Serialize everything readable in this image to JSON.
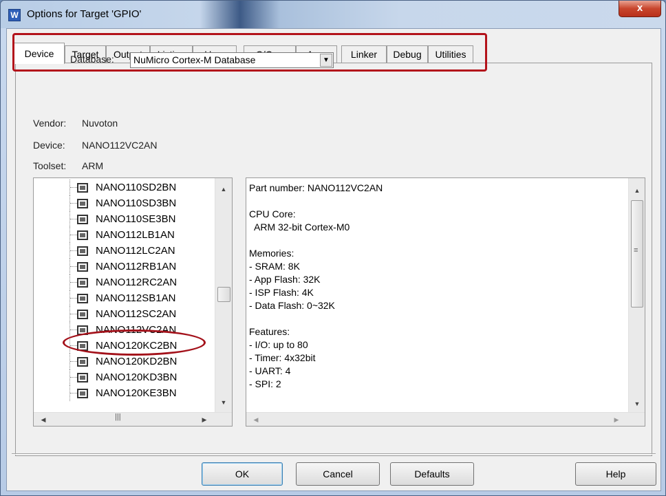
{
  "window": {
    "title": "Options for Target 'GPIO'",
    "close_glyph": "x",
    "app_icon_glyph": "W"
  },
  "tabs": [
    {
      "label": "Device",
      "active": true
    },
    {
      "label": "Target"
    },
    {
      "label": "Output"
    },
    {
      "label": "Listing"
    },
    {
      "label": "User"
    },
    {
      "label": "C/C++"
    },
    {
      "label": "Asm"
    },
    {
      "label": "Linker"
    },
    {
      "label": "Debug"
    },
    {
      "label": "Utilities"
    }
  ],
  "device": {
    "database_label": "Database:",
    "database_value": "NuMicro Cortex-M Database",
    "vendor_label": "Vendor:",
    "vendor_value": "Nuvoton",
    "device_label": "Device:",
    "device_value": "NANO112VC2AN",
    "toolset_label": "Toolset:",
    "toolset_value": "ARM"
  },
  "device_list": [
    "NANO110SD2BN",
    "NANO110SD3BN",
    "NANO110SE3BN",
    "NANO112LB1AN",
    "NANO112LC2AN",
    "NANO112RB1AN",
    "NANO112RC2AN",
    "NANO112SB1AN",
    "NANO112SC2AN",
    "NANO112VC2AN",
    "NANO120KC2BN",
    "NANO120KD2BN",
    "NANO120KD3BN",
    "NANO120KE3BN"
  ],
  "selected_device": "NANO112VC2AN",
  "description": [
    "Part number: NANO112VC2AN",
    "",
    "CPU Core:",
    "  ARM 32-bit Cortex-M0",
    "",
    "Memories:",
    "- SRAM: 8K",
    "- App Flash: 32K",
    "- ISP Flash: 4K",
    "- Data Flash: 0~32K",
    "",
    "Features:",
    "- I/O: up to 80",
    "- Timer: 4x32bit",
    "- UART: 4",
    "- SPI: 2"
  ],
  "buttons": {
    "ok": "OK",
    "cancel": "Cancel",
    "defaults": "Defaults",
    "help": "Help"
  },
  "scroll_glyphs": {
    "up": "▲",
    "down": "▼",
    "left": "◀",
    "right": "▶",
    "grip": "|||",
    "grip_h": "≡"
  }
}
